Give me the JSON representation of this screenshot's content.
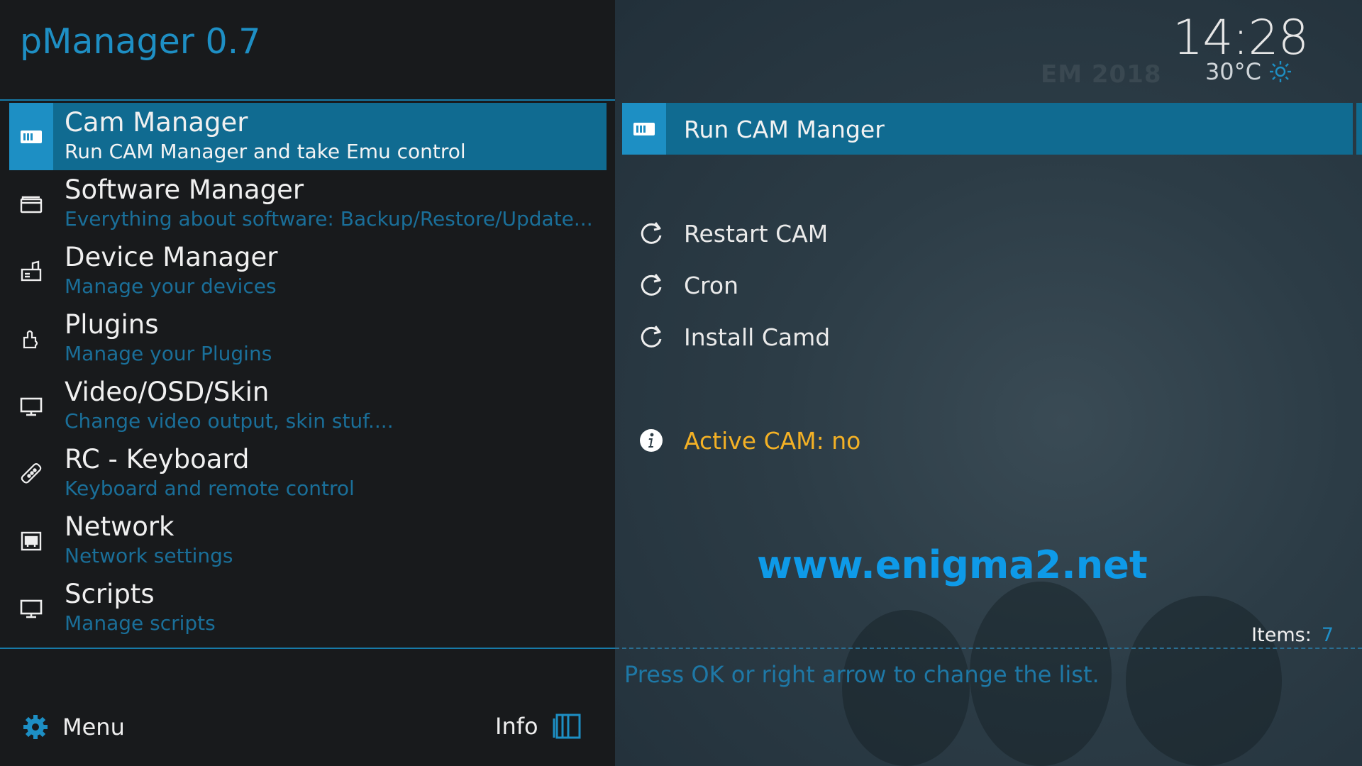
{
  "app": {
    "title": "pManager 0.7"
  },
  "menu": {
    "items": [
      {
        "title": "Cam Manager",
        "subtitle": "Run CAM Manager and take Emu control",
        "icon": "cam-card-icon",
        "selected": true
      },
      {
        "title": "Software Manager",
        "subtitle": "Everything about software: Backup/Restore/Update...",
        "icon": "folder-icon"
      },
      {
        "title": "Device Manager",
        "subtitle": "Manage your devices",
        "icon": "device-icon"
      },
      {
        "title": "Plugins",
        "subtitle": "Manage your Plugins",
        "icon": "plugin-icon"
      },
      {
        "title": "Video/OSD/Skin",
        "subtitle": "Change video output, skin stuf....",
        "icon": "monitor-icon"
      },
      {
        "title": "RC - Keyboard",
        "subtitle": "Keyboard and remote control",
        "icon": "remote-icon"
      },
      {
        "title": "Network",
        "subtitle": "Network settings",
        "icon": "network-icon"
      },
      {
        "title": "Scripts",
        "subtitle": "Manage scripts",
        "icon": "monitor-icon"
      }
    ]
  },
  "footer": {
    "menu_label": "Menu",
    "info_label": "Info"
  },
  "status": {
    "time": "14:28",
    "temperature": "30°C",
    "weather_icon": "sun-icon"
  },
  "options": {
    "selected": "Run CAM Manger",
    "items": [
      "Restart CAM",
      "Cron",
      "Install Camd"
    ],
    "active_status": "Active CAM: no"
  },
  "watermark": {
    "site": "www.enigma2.net",
    "background_text": "EM 2018"
  },
  "list_info": {
    "items_label": "Items:",
    "items_count": "7",
    "hint": "Press OK or right arrow to change the list."
  },
  "colors": {
    "accent": "#1d8fc4",
    "selected_bg": "#106b91",
    "warning": "#f4b125",
    "site": "#0e9ae8"
  }
}
